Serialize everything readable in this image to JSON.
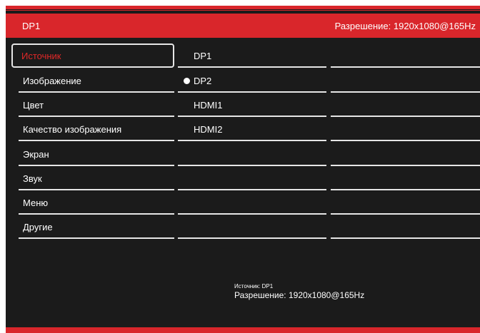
{
  "header": {
    "input_name": "DP1",
    "resolution": "Разрешение: 1920x1080@165Hz"
  },
  "menu": [
    {
      "label": "Источник",
      "selected": true
    },
    {
      "label": "Изображение"
    },
    {
      "label": "Цвет"
    },
    {
      "label": "Качество изображения"
    },
    {
      "label": "Экран"
    },
    {
      "label": "Звук"
    },
    {
      "label": "Меню"
    },
    {
      "label": "Другие"
    }
  ],
  "options": [
    {
      "label": "DP1",
      "current": false
    },
    {
      "label": "DP2",
      "current": true
    },
    {
      "label": "HDMI1",
      "current": false
    },
    {
      "label": "HDMI2",
      "current": false
    }
  ],
  "info": {
    "source": "Источник: DP1",
    "resolution": "Разрешение: 1920x1080@165Hz"
  },
  "colors": {
    "accent": "#d9262b",
    "background": "#1b1b1b",
    "selected_text": "#e02828"
  }
}
